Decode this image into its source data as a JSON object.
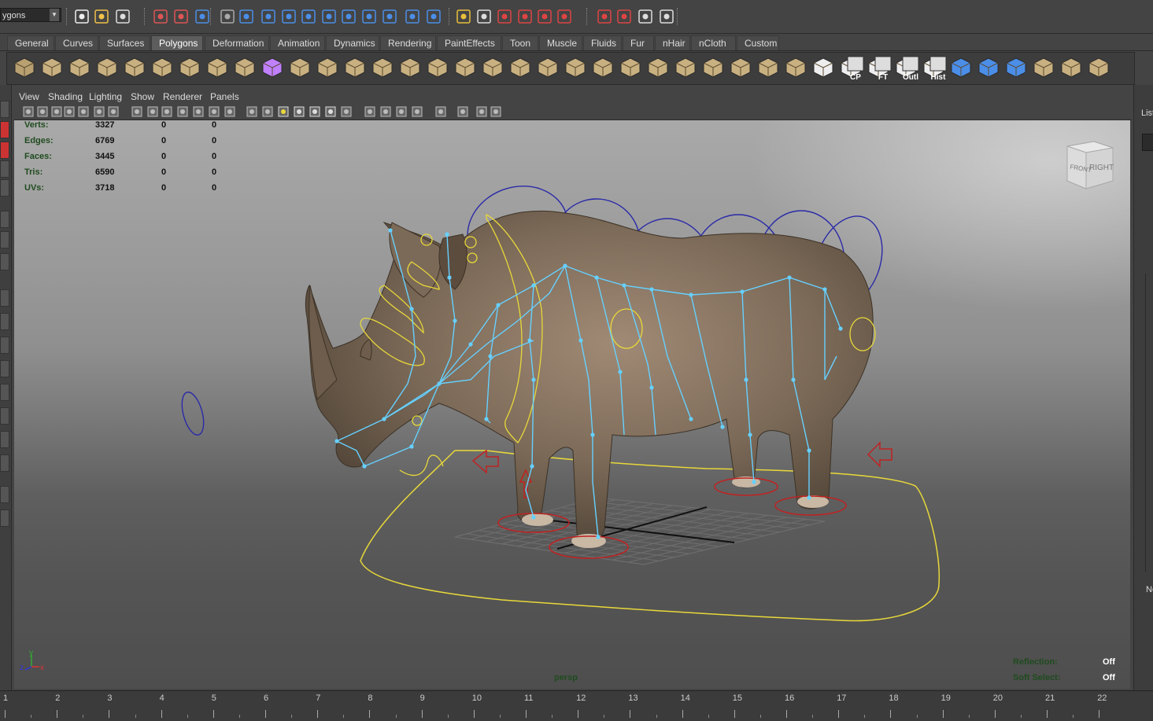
{
  "toolbar": {
    "mode_value": "ygons",
    "icons": [
      "new-scene-icon",
      "open-scene-icon",
      "save-scene-icon",
      "select-hierarchy-icon",
      "select-object-icon",
      "select-component-icon",
      "snap-grid-icon",
      "snap-curve-icon",
      "snap-point-icon",
      "snap-plane-icon",
      "make-live-icon",
      "history-icon",
      "render-icon",
      "ipr-icon",
      "render-settings-icon",
      "hypershade-icon",
      "help-icon",
      "lock-icon",
      "select-highlight-icon",
      "magnet-icon-1",
      "magnet-icon-2",
      "magnet-icon-3",
      "magnet-icon-4",
      "magnet-icon-5",
      "magnet-icon-6",
      "attribute-editor-icon",
      "tool-settings-icon",
      "channel-box-icon",
      "layer-editor-icon"
    ]
  },
  "shelf_tabs": [
    {
      "label": "General",
      "active": false
    },
    {
      "label": "Curves",
      "active": false
    },
    {
      "label": "Surfaces",
      "active": false
    },
    {
      "label": "Polygons",
      "active": true
    },
    {
      "label": "Deformation",
      "active": false
    },
    {
      "label": "Animation",
      "active": false
    },
    {
      "label": "Dynamics",
      "active": false
    },
    {
      "label": "Rendering",
      "active": false
    },
    {
      "label": "PaintEffects",
      "active": false
    },
    {
      "label": "Toon",
      "active": false
    },
    {
      "label": "Muscle",
      "active": false
    },
    {
      "label": "Fluids",
      "active": false
    },
    {
      "label": "Fur",
      "active": false
    },
    {
      "label": "nHair",
      "active": false
    },
    {
      "label": "nCloth",
      "active": false
    },
    {
      "label": "Custom",
      "active": false
    }
  ],
  "shelf_icon_labels": {
    "cp": "CP",
    "ft": "FT",
    "outl": "Outl",
    "hist": "Hist"
  },
  "panel_menu": [
    "View",
    "Shading",
    "Lighting",
    "Show",
    "Renderer",
    "Panels"
  ],
  "hud": {
    "rows": [
      {
        "label": "Verts:",
        "v1": "3327",
        "v2": "0",
        "v3": "0"
      },
      {
        "label": "Edges:",
        "v1": "6769",
        "v2": "0",
        "v3": "0"
      },
      {
        "label": "Faces:",
        "v1": "3445",
        "v2": "0",
        "v3": "0"
      },
      {
        "label": "Tris:",
        "v1": "6590",
        "v2": "0",
        "v3": "0"
      },
      {
        "label": "UVs:",
        "v1": "3718",
        "v2": "0",
        "v3": "0"
      }
    ],
    "reflection_label": "Reflection:",
    "reflection_value": "Off",
    "soft_select_label": "Soft Select:",
    "soft_select_value": "Off",
    "camera": "persp"
  },
  "viewcube": {
    "front": "FRONT",
    "right": "RIGHT"
  },
  "axis": {
    "x": "x",
    "y": "y",
    "z": "z"
  },
  "right_panel": {
    "top_text": "List",
    "bottom_text": "Ne"
  },
  "timeline": {
    "ticks": [
      "1",
      "2",
      "3",
      "4",
      "5",
      "6",
      "7",
      "8",
      "9",
      "10",
      "11",
      "12",
      "13",
      "14",
      "15",
      "16",
      "17",
      "18",
      "19",
      "20",
      "21",
      "22"
    ]
  },
  "colors": {
    "joint": "#66d0ff",
    "control_yellow": "#e8d83a",
    "control_blue": "#2a2aa8",
    "control_red": "#c02222",
    "viewport_top": "#a9a9a9",
    "viewport_bottom": "#4e4e4e"
  }
}
